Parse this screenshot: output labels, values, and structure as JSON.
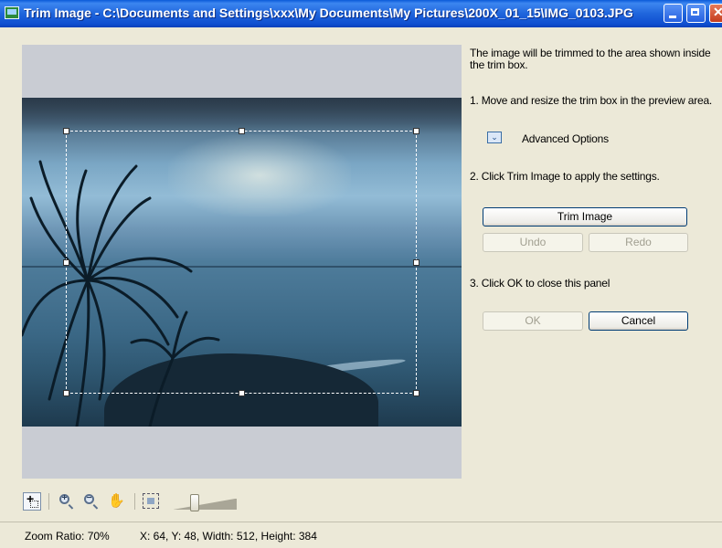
{
  "window": {
    "title": "Trim Image - C:\\Documents and Settings\\xxx\\My Documents\\My Pictures\\200X_01_15\\IMG_0103.JPG"
  },
  "panel": {
    "intro": "The image will be trimmed to the area shown inside the trim box.",
    "step1": "1.  Move and resize the trim box in the preview area.",
    "advanced_options_label": "Advanced Options",
    "step2": "2. Click Trim Image to apply the settings.",
    "trim_button": "Trim Image",
    "undo_button": "Undo",
    "redo_button": "Redo",
    "step3": "3. Click OK to close this panel",
    "ok_button": "OK",
    "cancel_button": "Cancel"
  },
  "toolbar": {
    "zoom_in_symbol": "+",
    "zoom_out_symbol": "−",
    "hand_glyph": "✋",
    "zoom_slider_value_fraction": 0.3
  },
  "status": {
    "zoom_ratio": "Zoom Ratio: 70%",
    "coords": "X: 64, Y: 48, Width: 512, Height: 384"
  },
  "colors": {
    "titlebar": "#0f4fd0",
    "panel_bg": "#ece9d8",
    "preview_bg": "#c9ccd3",
    "button_border": "#003c74",
    "disabled_text": "#a19f91"
  }
}
